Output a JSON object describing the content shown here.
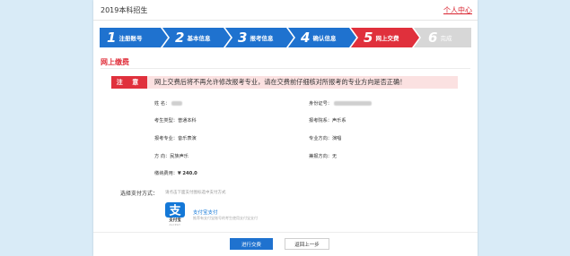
{
  "topbar": {
    "title": "2019本科招生",
    "user_center": "个人中心"
  },
  "steps": [
    {
      "num": "1",
      "label": "注册账号"
    },
    {
      "num": "2",
      "label": "基本信息"
    },
    {
      "num": "3",
      "label": "报考信息"
    },
    {
      "num": "4",
      "label": "确认信息"
    },
    {
      "num": "5",
      "label": "网上交费"
    },
    {
      "num": "6",
      "label": "完成"
    }
  ],
  "section": {
    "title": "网上缴费"
  },
  "notice": {
    "tag": "注 意",
    "message": "网上交费后将不再允许修改报考专业，请在交费前仔细核对所报考的专业方向是否正确！"
  },
  "info": {
    "name_label": "姓    名：",
    "id_label": "身份证号：",
    "type_label": "考生类型：",
    "type_value": "普通本科",
    "dept_label": "报考院系：",
    "dept_value": "声乐系",
    "major_label": "报考专业：",
    "major_value": "音乐表演",
    "direction_label": "专业方向：",
    "direction_value": "演唱",
    "dir2_label": "方    向：",
    "dir2_value": "民族声乐",
    "dual_label": "兼报方向：",
    "dual_value": "无",
    "fee_label": "缴纳费用：",
    "fee_value": "¥ 240.0"
  },
  "payment": {
    "label": "选择支付方式：",
    "hint": "请点击下面支付图标选中支付方式",
    "alipay_logo_text": "支付宝",
    "alipay_logo_sub": "ALIPAY",
    "alipay_name": "支付宝支付",
    "alipay_desc": "推荐有支付宝账号的考生使用支付宝支付"
  },
  "buttons": {
    "pay": "进行交费",
    "back": "返回上一步"
  },
  "colors": {
    "primary": "#1f72cf",
    "accent": "#e0303c",
    "background": "#d9ebf7"
  }
}
